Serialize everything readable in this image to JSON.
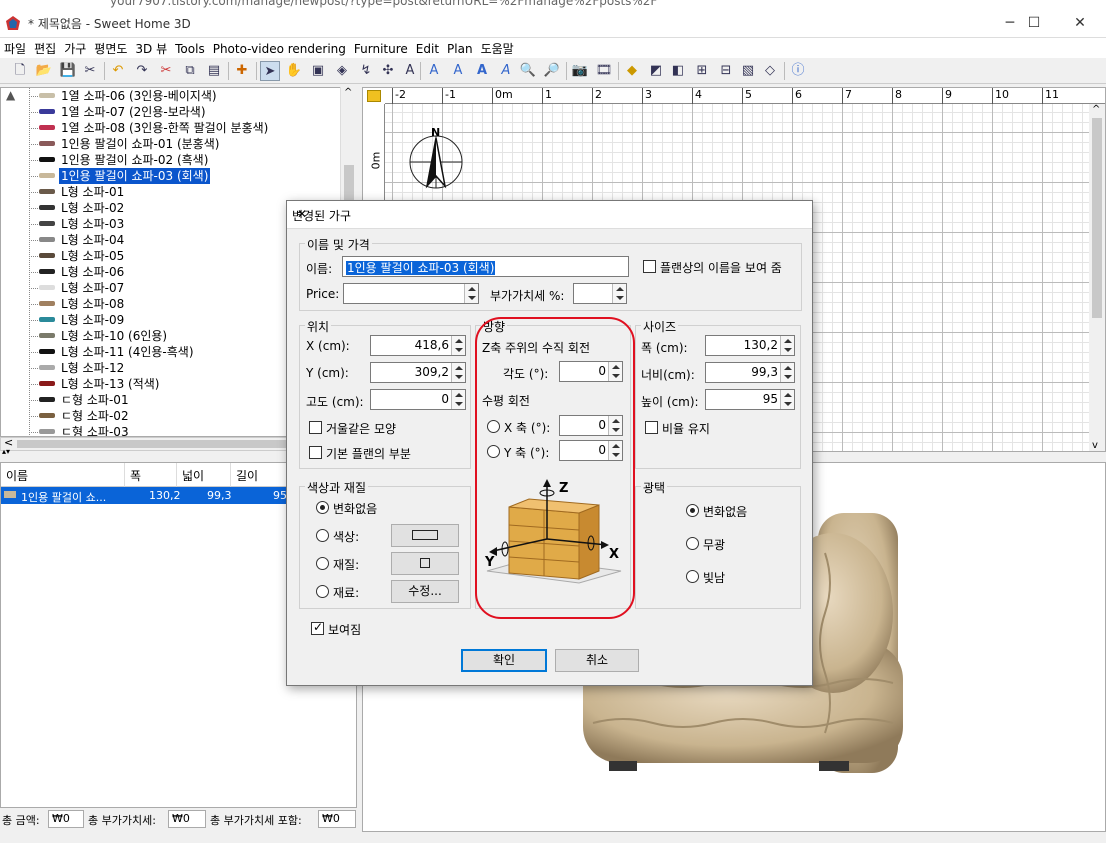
{
  "browser": {
    "url_fragment": "your7907.tistory.com/manage/newpost/?type=post&returnURL=%2Fmanage%2Fposts%2F"
  },
  "window": {
    "title": "* 제목없음 - Sweet Home 3D",
    "minimize": "─",
    "maximize": "☐",
    "close": "✕"
  },
  "menu": [
    "파일",
    "편집",
    "가구",
    "평면도",
    "3D 뷰",
    "Tools",
    "Photo-video rendering",
    "Furniture",
    "Edit",
    "Plan",
    "도움말"
  ],
  "catalog": {
    "items": [
      {
        "label": "1열 소파-06 (3인용-베이지색)",
        "color": "#c8bfa8"
      },
      {
        "label": "1열 소파-07 (2인용-보라색)",
        "color": "#3a3a9a"
      },
      {
        "label": "1열 소파-08 (3인용-한쪽 팔걸이 분홍색)",
        "color": "#c03050"
      },
      {
        "label": "1인용 팔걸이 쇼파-01 (분홍색)",
        "color": "#8a5a5a"
      },
      {
        "label": "1인용 팔걸이 쇼파-02 (흑색)",
        "color": "#111111"
      },
      {
        "label": "1인용 팔걸이 쇼파-03 (회색)",
        "color": "#c8b89a"
      },
      {
        "label": "L형 소파-01",
        "color": "#6a5a4a"
      },
      {
        "label": "L형 소파-02",
        "color": "#333333"
      },
      {
        "label": "L형 소파-03",
        "color": "#444444"
      },
      {
        "label": "L형 소파-04",
        "color": "#888888"
      },
      {
        "label": "L형 소파-05",
        "color": "#5a4a3a"
      },
      {
        "label": "L형 소파-06",
        "color": "#222222"
      },
      {
        "label": "L형 소파-07",
        "color": "#dddddd"
      },
      {
        "label": "L형 소파-08",
        "color": "#a08060"
      },
      {
        "label": "L형 소파-09",
        "color": "#2a8a9a"
      },
      {
        "label": "L형 소파-10 (6인용)",
        "color": "#7a7a6a"
      },
      {
        "label": "L형 소파-11 (4인용-흑색)",
        "color": "#111111"
      },
      {
        "label": "L형 소파-12",
        "color": "#aaaaaa"
      },
      {
        "label": "L형 소파-13 (적색)",
        "color": "#8a1a1a"
      },
      {
        "label": "ㄷ형 소파-01",
        "color": "#222222"
      },
      {
        "label": "ㄷ형 소파-02",
        "color": "#7a6040"
      },
      {
        "label": "ㄷ형 소파-03",
        "color": "#999999"
      }
    ],
    "selected_index": 5
  },
  "furniture_table": {
    "headers": [
      "이름",
      "폭",
      "넓이",
      "길이"
    ],
    "row": {
      "name": "1인용 팔걸이 쇼...",
      "width": "130,2",
      "depth": "99,3",
      "height": "95"
    }
  },
  "status": {
    "total_label": "총 금액:",
    "total": "₩0",
    "vat_label": "총 부가가치세:",
    "vat": "₩0",
    "incl_label": "총 부가가치세 포함:",
    "incl": "₩0"
  },
  "plan": {
    "ruler_ticks": [
      "-2",
      "-1",
      "0m",
      "1",
      "2",
      "3",
      "4",
      "5",
      "6",
      "7",
      "8",
      "9",
      "10",
      "11"
    ],
    "left_ticks": [
      "0m",
      "1"
    ],
    "compass_label": "N"
  },
  "dialog": {
    "title": "변경된 가구",
    "close": "✕",
    "name_price": {
      "legend": "이름 및 가격",
      "name_label": "이름:",
      "name_value": "1인용 팔걸이 쇼파-03 (회색)",
      "show_name_label": "플랜상의 이름을 보여 줌",
      "show_name_checked": false,
      "price_label": "Price:",
      "price_value": "",
      "vat_label": "부가가치세 %:",
      "vat_value": ""
    },
    "position": {
      "legend": "위치",
      "x_label": "X (cm):",
      "x_value": "418,6",
      "y_label": "Y (cm):",
      "y_value": "309,2",
      "elev_label": "고도 (cm):",
      "elev_value": "0",
      "mirror_label": "거울같은 모양",
      "mirror_checked": false,
      "base_plan_label": "기본 플랜의 부분",
      "base_plan_checked": false
    },
    "orientation": {
      "legend": "방향",
      "z_rot_label": "Z축 주위의 수직 회전",
      "angle_label": "각도 (°):",
      "angle_value": "0",
      "horiz_label": "수평 회전",
      "x_axis_label": "X 축 (°):",
      "x_axis_value": "0",
      "y_axis_label": "Y 축 (°):",
      "y_axis_value": "0",
      "axis_z": "Z",
      "axis_x": "X",
      "axis_y": "Y"
    },
    "size": {
      "legend": "사이즈",
      "width_label": "폭 (cm):",
      "width_value": "130,2",
      "depth_label": "너비(cm):",
      "depth_value": "99,3",
      "height_label": "높이 (cm):",
      "height_value": "95",
      "keep_ratio_label": "비율 유지",
      "keep_ratio_checked": false
    },
    "color": {
      "legend": "색상과 재질",
      "unchanged_label": "변화없음",
      "color_label": "색상:",
      "texture_label": "재질:",
      "materials_label": "재료:",
      "modify_label": "수정...",
      "selected": "unchanged"
    },
    "shininess": {
      "legend": "광택",
      "unchanged_label": "변화없음",
      "matte_label": "무광",
      "shiny_label": "빛남",
      "selected": "unchanged"
    },
    "visible_label": "보여짐",
    "visible_checked": true,
    "ok_label": "확인",
    "cancel_label": "취소"
  },
  "colors": {
    "selection": "#0a64d8",
    "highlight": "#e01020",
    "dresser": "#d9a94a"
  }
}
